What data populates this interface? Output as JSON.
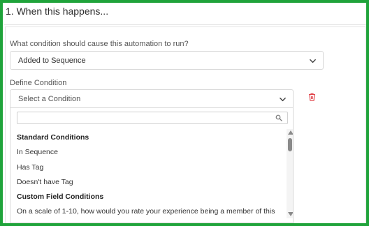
{
  "section": {
    "title": "1. When this happens..."
  },
  "trigger": {
    "question": "What condition should cause this automation to run?",
    "selected": "Added to Sequence"
  },
  "condition": {
    "label": "Define Condition",
    "placeholder": "Select a Condition",
    "search_value": "",
    "options": [
      {
        "text": "Standard Conditions",
        "group": true
      },
      {
        "text": "In Sequence",
        "group": false
      },
      {
        "text": "Has Tag",
        "group": false
      },
      {
        "text": "Doesn't have Tag",
        "group": false
      },
      {
        "text": "Custom Field Conditions",
        "group": true
      },
      {
        "text": "On a scale of 1-10, how would you rate your experience being a member of this",
        "group": false
      }
    ]
  },
  "colors": {
    "frame": "#1fa33a",
    "delete_icon": "#e0434a"
  },
  "icons": {
    "dropdown": "chevron-down-icon",
    "delete": "trash-icon",
    "search": "search-icon"
  }
}
